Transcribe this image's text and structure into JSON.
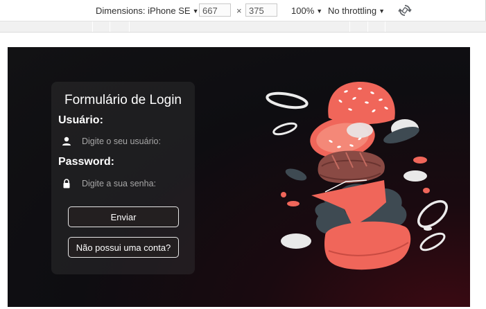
{
  "devtools": {
    "device_label": "Dimensions: iPhone SE",
    "width": "667",
    "times": "×",
    "height": "375",
    "zoom": "100%",
    "throttling": "No throttling"
  },
  "login": {
    "title": "Formulário de Login",
    "username_label": "Usuário:",
    "username_placeholder": "Digite o seu usuário:",
    "password_label": "Password:",
    "password_placeholder": "Digite a sua senha:",
    "submit_label": "Enviar",
    "signup_label": "Não possui uma conta?"
  },
  "colors": {
    "page_bg": "#121214",
    "card_bg": "#2b2b2b",
    "accent_red": "#f0665a",
    "bun_dark": "#7a3e3a",
    "lettuce": "#3e4a52"
  }
}
